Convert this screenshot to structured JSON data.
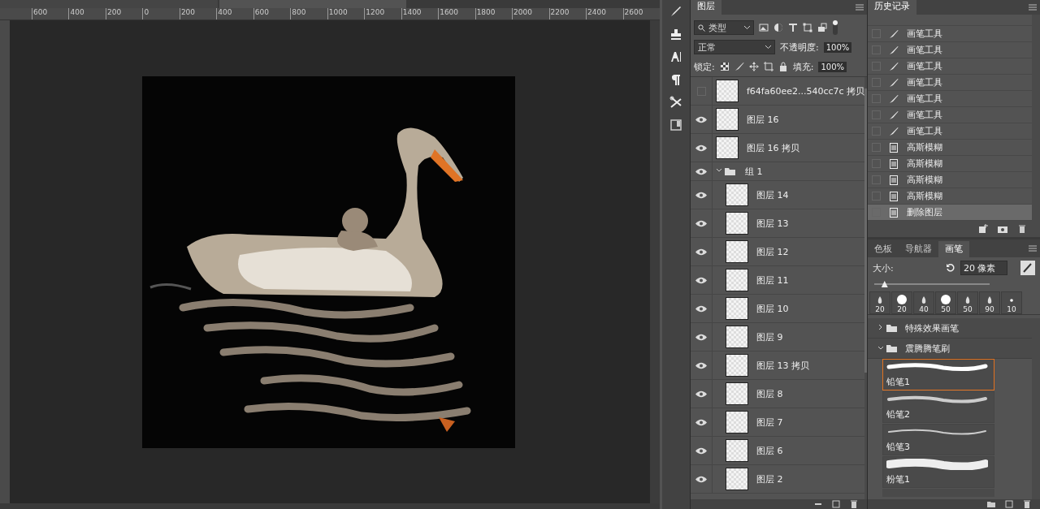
{
  "ruler": {
    "top_labels": [
      "600",
      "400",
      "200",
      "0",
      "200",
      "400",
      "600",
      "800",
      "1000",
      "1200",
      "1400",
      "1600",
      "1800",
      "2000",
      "2200",
      "2400",
      "2600"
    ]
  },
  "layers_panel": {
    "title": "图层",
    "filter": {
      "value": "类型"
    },
    "blend_mode": {
      "value": "正常"
    },
    "opacity": {
      "label": "不透明度:",
      "value": "100%"
    },
    "lock": {
      "label": "锁定:"
    },
    "fill": {
      "label": "填充:",
      "value": "100%"
    },
    "layers": [
      {
        "kind": "layer",
        "name": "f64fa60ee2...540cc7c 拷贝",
        "visible": false
      },
      {
        "kind": "layer",
        "name": "图层 16",
        "visible": true
      },
      {
        "kind": "layer",
        "name": "图层 16 拷贝",
        "visible": true
      },
      {
        "kind": "group",
        "name": "组 1",
        "visible": true,
        "expanded": true,
        "children": [
          {
            "kind": "layer",
            "name": "图层 14",
            "visible": true
          },
          {
            "kind": "layer",
            "name": "图层 13",
            "visible": true
          },
          {
            "kind": "layer",
            "name": "图层 12",
            "visible": true
          },
          {
            "kind": "layer",
            "name": "图层 11",
            "visible": true
          },
          {
            "kind": "layer",
            "name": "图层 10",
            "visible": true
          },
          {
            "kind": "layer",
            "name": "图层 9",
            "visible": true
          },
          {
            "kind": "layer",
            "name": "图层 13 拷贝",
            "visible": true
          },
          {
            "kind": "layer",
            "name": "图层 8",
            "visible": true
          },
          {
            "kind": "layer",
            "name": "图层 7",
            "visible": true
          },
          {
            "kind": "layer",
            "name": "图层 6",
            "visible": true
          },
          {
            "kind": "layer",
            "name": "图层 2",
            "visible": true
          }
        ]
      }
    ]
  },
  "history_panel": {
    "title": "历史记录",
    "items": [
      {
        "kind": "brush",
        "label": "画笔工具",
        "selected": false
      },
      {
        "kind": "brush",
        "label": "画笔工具",
        "selected": false
      },
      {
        "kind": "brush",
        "label": "画笔工具",
        "selected": false
      },
      {
        "kind": "brush",
        "label": "画笔工具",
        "selected": false
      },
      {
        "kind": "brush",
        "label": "画笔工具",
        "selected": false
      },
      {
        "kind": "brush",
        "label": "画笔工具",
        "selected": false
      },
      {
        "kind": "brush",
        "label": "画笔工具",
        "selected": false
      },
      {
        "kind": "filter",
        "label": "高斯模糊",
        "selected": false
      },
      {
        "kind": "filter",
        "label": "高斯模糊",
        "selected": false
      },
      {
        "kind": "filter",
        "label": "高斯模糊",
        "selected": false
      },
      {
        "kind": "filter",
        "label": "高斯模糊",
        "selected": false
      },
      {
        "kind": "filter",
        "label": "删除图层",
        "selected": true
      }
    ]
  },
  "brush_panel": {
    "tabs": [
      {
        "label": "色板",
        "selected": false
      },
      {
        "label": "导航器",
        "selected": false
      },
      {
        "label": "画笔",
        "selected": true
      }
    ],
    "size": {
      "label": "大小:",
      "value": "20 像素",
      "level": 0.09
    },
    "presets": [
      {
        "kind": "soft",
        "size": "20"
      },
      {
        "kind": "hard",
        "size": "20"
      },
      {
        "kind": "soft",
        "size": "40"
      },
      {
        "kind": "hard",
        "size": "50"
      },
      {
        "kind": "soft",
        "size": "50"
      },
      {
        "kind": "soft",
        "size": "90"
      },
      {
        "kind": "dot",
        "size": "10"
      }
    ],
    "folders": [
      {
        "name": "特殊效果画笔",
        "expanded": false
      },
      {
        "name": "震腾腾笔刷",
        "expanded": true
      }
    ],
    "brushes": [
      {
        "kind": "pencil",
        "name": "铅笔1",
        "selected": true
      },
      {
        "kind": "grainy",
        "name": "铅笔2",
        "selected": false
      },
      {
        "kind": "thin",
        "name": "铅笔3",
        "selected": false
      },
      {
        "kind": "chalk",
        "name": "粉笔1",
        "selected": false
      }
    ]
  }
}
